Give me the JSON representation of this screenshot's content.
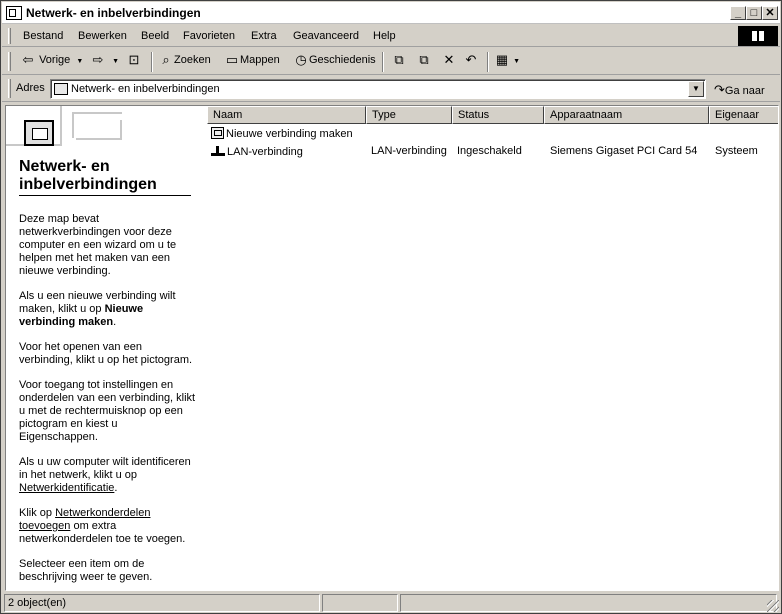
{
  "window": {
    "title": "Netwerk- en inbelverbindingen"
  },
  "window_buttons": {
    "minimize": "_",
    "maximize": "□",
    "close": "✕"
  },
  "menu": {
    "items": [
      "Bestand",
      "Bewerken",
      "Beeld",
      "Favorieten",
      "Extra",
      "Geavanceerd",
      "Help"
    ]
  },
  "toolbar": {
    "back": "Vorige",
    "search": "Zoeken",
    "folders": "Mappen",
    "history": "Geschiedenis"
  },
  "address": {
    "label": "Adres",
    "value": "Netwerk- en inbelverbindingen",
    "go": "Ga naar"
  },
  "left_pane": {
    "title": "Netwerk- en inbelverbindingen",
    "p1": "Deze map bevat netwerkverbindingen voor deze computer en een wizard om u te helpen met het maken van een nieuwe verbinding.",
    "p2_pre": "Als u een nieuwe verbinding wilt maken, klikt u op ",
    "p2_bold": "Nieuwe verbinding maken",
    "p2_post": ".",
    "p3": "Voor het openen van een verbinding, klikt u op het pictogram.",
    "p4": "Voor toegang tot instellingen en onderdelen van een verbinding, klikt u met de rechtermuisknop op een pictogram en kiest u Eigenschappen.",
    "p5_pre": "Als u uw computer wilt identificeren in het netwerk, klikt u op ",
    "p5_link": "Netwerkidentificatie",
    "p5_post": ".",
    "p6_pre": "Klik op ",
    "p6_link": "Netwerkonderdelen toevoegen",
    "p6_post": " om extra netwerkonderdelen toe te voegen.",
    "p7": "Selecteer een item om de beschrijving weer te geven."
  },
  "list": {
    "columns": [
      "Naam",
      "Type",
      "Status",
      "Apparaatnaam",
      "Eigenaar"
    ],
    "rows": [
      {
        "name": "Nieuwe verbinding maken",
        "type": "",
        "status": "",
        "device": "",
        "owner": "",
        "icon": "wizard-icon"
      },
      {
        "name": "LAN-verbinding",
        "type": "LAN-verbinding",
        "status": "Ingeschakeld",
        "device": "Siemens Gigaset PCI Card 54",
        "owner": "Systeem",
        "icon": "lan-connection-icon"
      }
    ]
  },
  "status": {
    "count": "2 object(en)"
  }
}
